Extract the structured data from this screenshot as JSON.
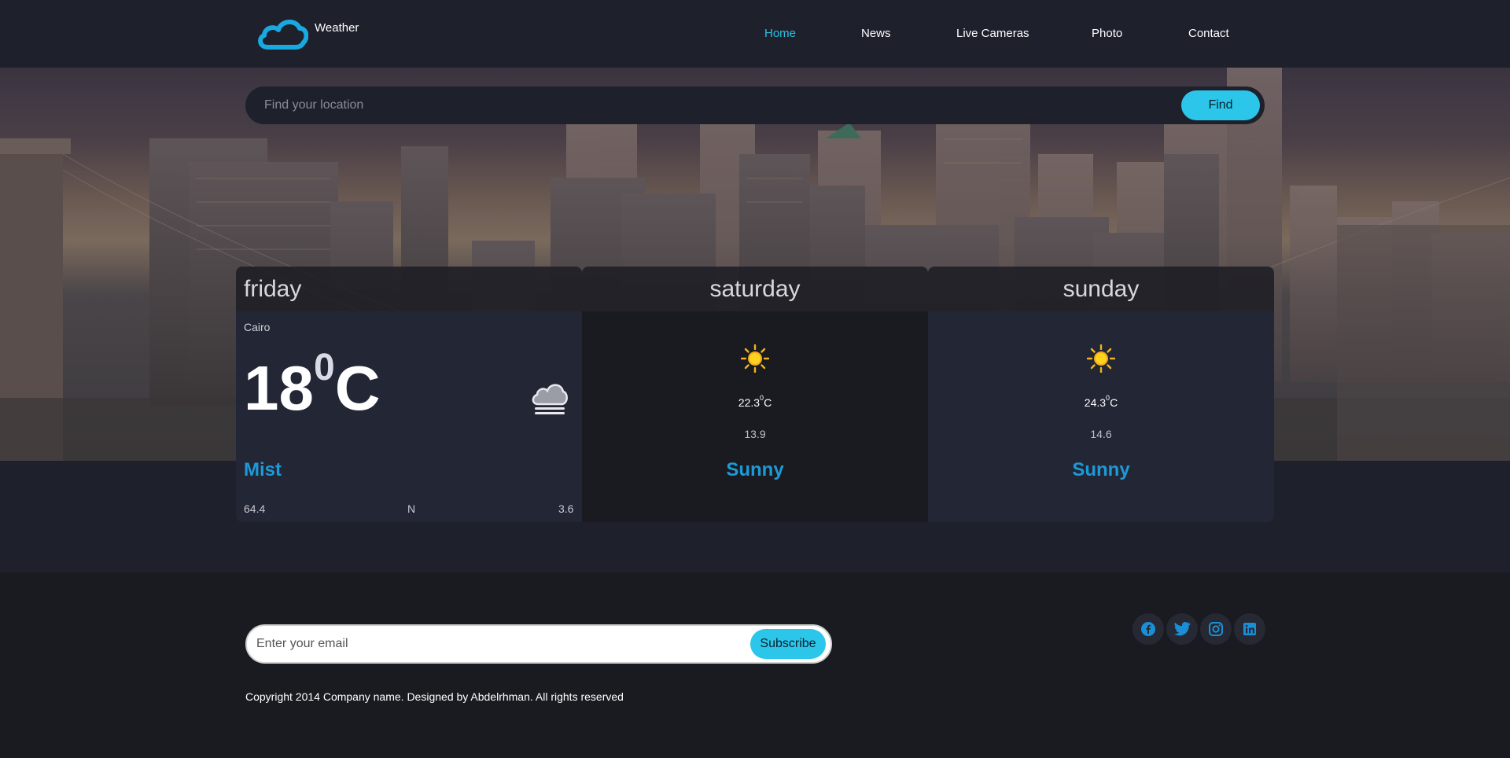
{
  "brand": {
    "name": "Weather",
    "icon": "cloud-icon"
  },
  "nav": {
    "items": [
      {
        "label": "Home",
        "active": true
      },
      {
        "label": "News",
        "active": false
      },
      {
        "label": "Live Cameras",
        "active": false
      },
      {
        "label": "Photo",
        "active": false
      },
      {
        "label": "Contact",
        "active": false
      }
    ]
  },
  "search": {
    "placeholder": "Find your location",
    "button_label": "Find"
  },
  "today": {
    "day": "friday",
    "city": "Cairo",
    "temp": "18",
    "degree": "0",
    "unit": "C",
    "icon": "cloud-icon",
    "condition": "Mist",
    "humidity": "64.4",
    "wind_dir": "N",
    "wind_speed": "3.6"
  },
  "forecast": [
    {
      "day": "saturday",
      "icon": "sun-icon",
      "max": "22.3",
      "degree": "0",
      "unit": "C",
      "min": "13.9",
      "condition": "Sunny"
    },
    {
      "day": "sunday",
      "icon": "sun-icon",
      "max": "24.3",
      "degree": "0",
      "unit": "C",
      "min": "14.6",
      "condition": "Sunny"
    }
  ],
  "footer": {
    "email_placeholder": "Enter your email",
    "subscribe_label": "Subscribe",
    "copyright": "Copyright 2014 Company name. Designed by Abdelrhman. All rights reserved",
    "socials": [
      "facebook-icon",
      "twitter-icon",
      "instagram-icon",
      "linkedin-icon"
    ]
  },
  "colors": {
    "accent": "#2bc6ea",
    "nav_active": "#2bc0e4",
    "condition": "#1c9ad8",
    "background": "#1e202b",
    "card": "#232635",
    "card_alt": "#1a1b21"
  }
}
